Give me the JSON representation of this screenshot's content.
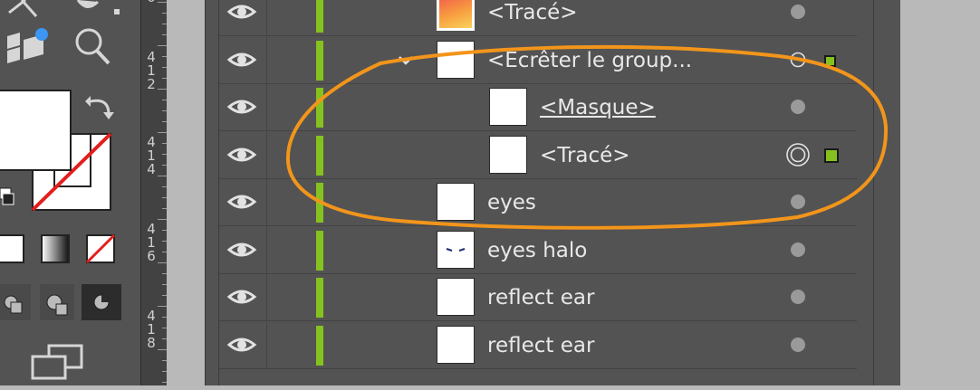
{
  "ruler": {
    "labels": [
      {
        "text": "0"
      },
      {
        "text": "4\n1\n2"
      },
      {
        "text": "4\n1\n4"
      },
      {
        "text": "4\n1\n6"
      },
      {
        "text": "4\n1\n8"
      }
    ]
  },
  "layers": [
    {
      "name": "<Tracé>",
      "thumb": "gradient",
      "level": 0,
      "expanded": false,
      "target": "circle",
      "selected": false,
      "underline": false
    },
    {
      "name": "<Ecrêter le group...",
      "thumb": "white",
      "level": 0,
      "expanded": true,
      "target": "ring",
      "selected": true,
      "underline": false
    },
    {
      "name": "<Masque>",
      "thumb": "white",
      "level": 1,
      "expanded": false,
      "target": "circle",
      "selected": false,
      "underline": true
    },
    {
      "name": "<Tracé>",
      "thumb": "white",
      "level": 1,
      "expanded": false,
      "target": "double-ring",
      "selected": true,
      "underline": false
    },
    {
      "name": "eyes",
      "thumb": "white",
      "level": 0,
      "expanded": false,
      "target": "circle",
      "selected": false,
      "underline": false
    },
    {
      "name": "eyes halo",
      "thumb": "eyes",
      "level": 0,
      "expanded": false,
      "target": "circle",
      "selected": false,
      "underline": false
    },
    {
      "name": "reflect ear",
      "thumb": "white",
      "level": 0,
      "expanded": false,
      "target": "circle",
      "selected": false,
      "underline": false
    },
    {
      "name": "reflect ear",
      "thumb": "white",
      "level": 0,
      "expanded": false,
      "target": "circle",
      "selected": false,
      "underline": false
    }
  ],
  "colors": {
    "layer_color": "#86c21f",
    "annotation": "#f2951b",
    "panel_bg": "#535353"
  },
  "icons": [
    "eye-icon",
    "chevron-down-icon",
    "target-circle-icon",
    "magnifier-icon",
    "swap-arrow-icon",
    "fill-swatch-icon",
    "stroke-none-icon"
  ]
}
